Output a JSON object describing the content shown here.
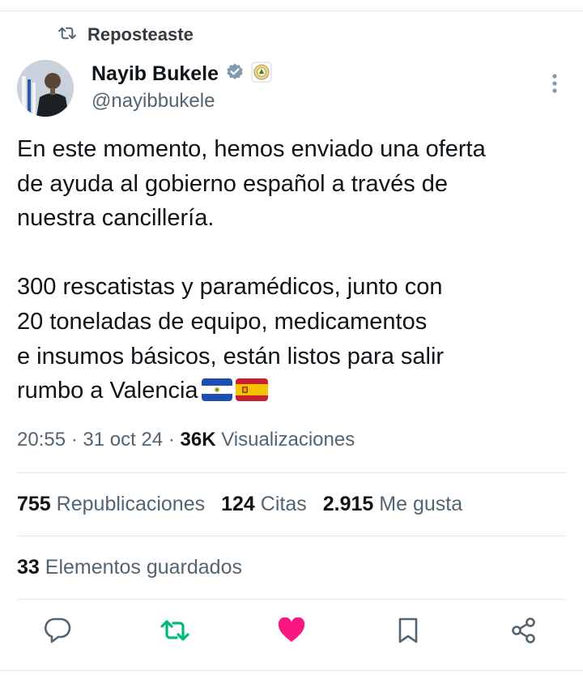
{
  "repost": {
    "label": "Reposteaste"
  },
  "author": {
    "display_name": "Nayib Bukele",
    "handle": "@nayibbukele"
  },
  "tweet": {
    "text": "En este momento, hemos enviado una oferta\nde ayuda al gobierno español a través de\nnuestra cancillería.\n\n300 rescatistas y paramédicos, junto con\n20 toneladas de equipo, medicamentos\ne insumos básicos, están listos para salir\nrumbo a Valencia"
  },
  "meta": {
    "time": "20:55",
    "date": "31 oct 24",
    "views_count": "36K",
    "views_label": "Visualizaciones"
  },
  "stats": {
    "reposts_count": "755",
    "reposts_label": "Republicaciones",
    "quotes_count": "124",
    "quotes_label": "Citas",
    "likes_count": "2.915",
    "likes_label": "Me gusta",
    "saved_count": "33",
    "saved_label": "Elementos guardados"
  },
  "icons": {
    "repost": "repost-icon",
    "verified": "verified-badge-icon",
    "affiliate": "government-seal-icon",
    "more": "more-vertical-icon",
    "reply": "reply-icon",
    "like": "heart-icon",
    "bookmark": "bookmark-icon",
    "share": "share-icon",
    "flag_sv": "el-salvador-flag-icon",
    "flag_es": "spain-flag-icon"
  },
  "colors": {
    "repost_active": "#00ba7c",
    "like_active": "#f91880",
    "verified": "#829aab",
    "secondary_text": "#536471"
  }
}
